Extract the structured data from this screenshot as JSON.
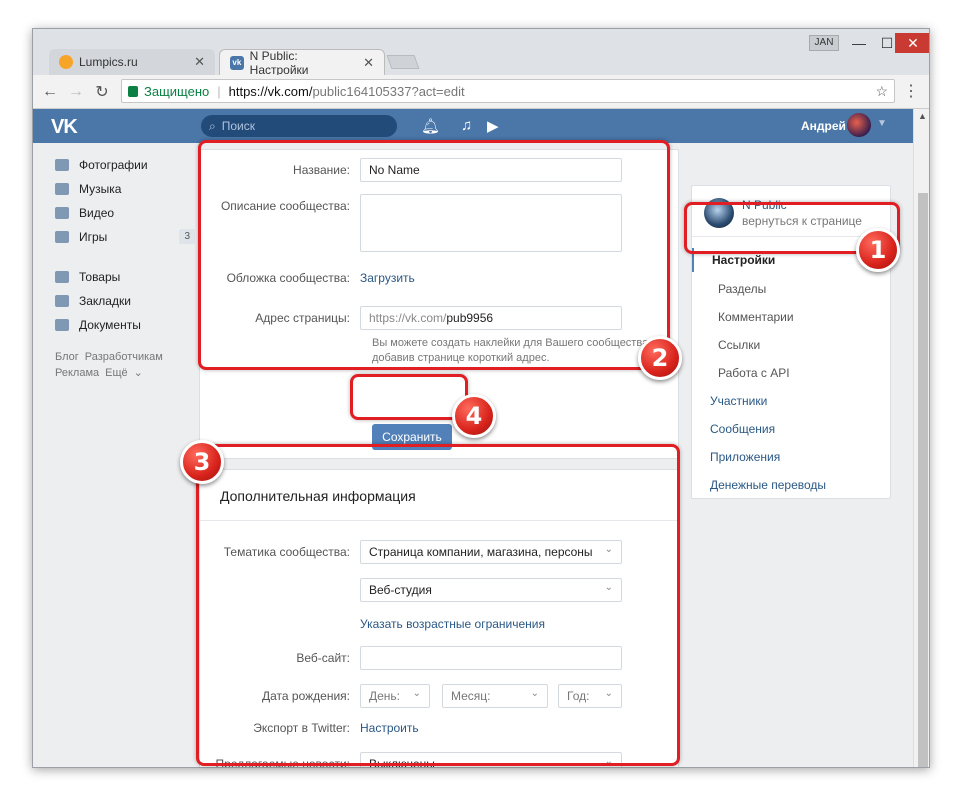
{
  "browser": {
    "tabs": [
      {
        "title": "Lumpics.ru"
      },
      {
        "title": "N Public: Настройки"
      }
    ],
    "user_badge": "JAN",
    "window_controls": {
      "minimize": "—",
      "maximize": "☐",
      "close": "✕"
    },
    "address": {
      "secure_label": "Защищено",
      "url_host": "https://vk.com/",
      "url_path": "public164105337?act=edit"
    }
  },
  "vk_header": {
    "logo": "VK",
    "search_placeholder": "Поиск",
    "user_name": "Андрей"
  },
  "left_nav": {
    "items": [
      {
        "label": "Фотографии"
      },
      {
        "label": "Музыка"
      },
      {
        "label": "Видео"
      },
      {
        "label": "Игры",
        "count": "3"
      },
      {
        "label": "Товары"
      },
      {
        "label": "Закладки"
      },
      {
        "label": "Документы"
      }
    ],
    "footer": [
      "Блог",
      "Разработчикам",
      "Реклама",
      "Ещё"
    ]
  },
  "main_form": {
    "name_label": "Название:",
    "name_value": "No Name",
    "description_label": "Описание сообщества:",
    "cover_label": "Обложка сообщества:",
    "cover_link": "Загрузить",
    "address_label": "Адрес страницы:",
    "address_prefix": "https://vk.com/",
    "address_value": "pub9956",
    "address_note": "Вы можете создать наклейки для Вашего сообщества добавив странице короткий адрес.",
    "save_button": "Сохранить"
  },
  "extra_info": {
    "title": "Дополнительная информация",
    "topic_label": "Тематика сообщества:",
    "topic_value": "Страница компании, магазина, персоны",
    "subtopic_value": "Веб-студия",
    "age_link": "Указать возрастные ограничения",
    "website_label": "Веб-сайт:",
    "birth_label": "Дата рождения:",
    "day_placeholder": "День:",
    "month_placeholder": "Месяц:",
    "year_placeholder": "Год:",
    "twitter_label": "Экспорт в Twitter:",
    "twitter_link": "Настроить",
    "news_label": "Предлагаемые новости:",
    "news_value": "Выключены"
  },
  "right_menu": {
    "community_name": "N Public",
    "back_link": "вернуться к странице",
    "items": [
      {
        "label": "Настройки"
      },
      {
        "label": "Разделы"
      },
      {
        "label": "Комментарии"
      },
      {
        "label": "Ссылки"
      },
      {
        "label": "Работа с API"
      },
      {
        "label": "Участники"
      },
      {
        "label": "Сообщения"
      },
      {
        "label": "Приложения"
      },
      {
        "label": "Денежные переводы"
      }
    ]
  },
  "annotations": [
    "1",
    "2",
    "3",
    "4"
  ],
  "colors": {
    "vk_blue": "#4a76a8",
    "button_blue": "#5181b8",
    "link_blue": "#2a5885",
    "highlight_red": "#e01e24"
  }
}
